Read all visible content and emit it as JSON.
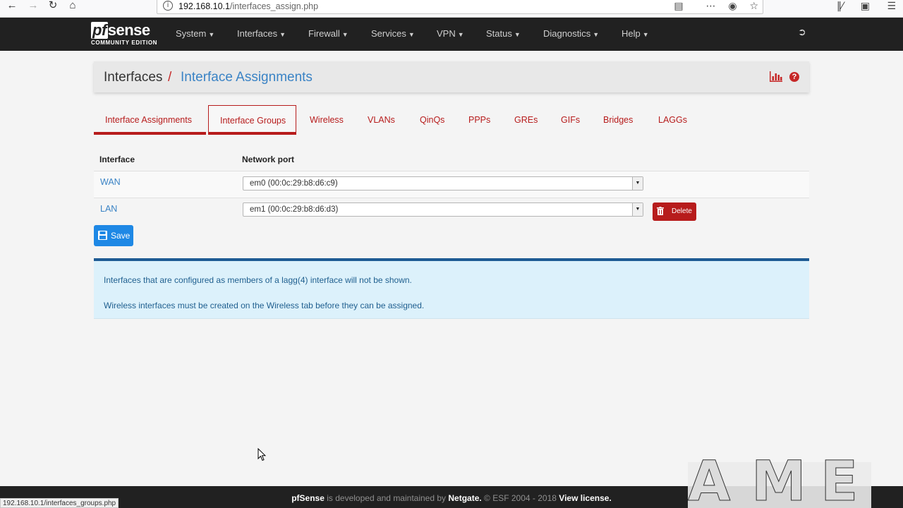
{
  "browser": {
    "url_host": "192.168.10.1",
    "url_path": "/interfaces_assign.php",
    "status_url": "192.168.10.1/interfaces_groups.php"
  },
  "logo": {
    "pf": "pf",
    "sense": "sense",
    "edition": "COMMUNITY EDITION"
  },
  "nav": {
    "items": [
      {
        "label": "System"
      },
      {
        "label": "Interfaces"
      },
      {
        "label": "Firewall"
      },
      {
        "label": "Services"
      },
      {
        "label": "VPN"
      },
      {
        "label": "Status"
      },
      {
        "label": "Diagnostics"
      },
      {
        "label": "Help"
      }
    ]
  },
  "breadcrumb": {
    "parent": "Interfaces",
    "separator": "/",
    "current": "Interface Assignments"
  },
  "tabs": [
    {
      "label": "Interface Assignments"
    },
    {
      "label": "Interface Groups"
    },
    {
      "label": "Wireless"
    },
    {
      "label": "VLANs"
    },
    {
      "label": "QinQs"
    },
    {
      "label": "PPPs"
    },
    {
      "label": "GREs"
    },
    {
      "label": "GIFs"
    },
    {
      "label": "Bridges"
    },
    {
      "label": "LAGGs"
    }
  ],
  "table": {
    "headers": {
      "interface": "Interface",
      "port": "Network port"
    },
    "rows": [
      {
        "interface": "WAN",
        "port": "em0 (00:0c:29:b8:d6:c9)"
      },
      {
        "interface": "LAN",
        "port": "em1 (00:0c:29:b8:d6:d3)",
        "action": "Delete"
      }
    ]
  },
  "save_label": "Save",
  "info": [
    "Interfaces that are configured as members of a lagg(4) interface will not be shown.",
    "Wireless interfaces must be created on the Wireless tab before they can be assigned."
  ],
  "footer": {
    "brand": "pfSense",
    "text1": " is developed and maintained by ",
    "company": "Netgate.",
    "text2": " © ESF 2004 - 2018 ",
    "license": "View license."
  },
  "watermark": "AME",
  "colors": {
    "accent_red": "#b71c1c",
    "link_blue": "#3a83c5",
    "navbar": "#212121",
    "save_blue": "#1e88e5"
  }
}
